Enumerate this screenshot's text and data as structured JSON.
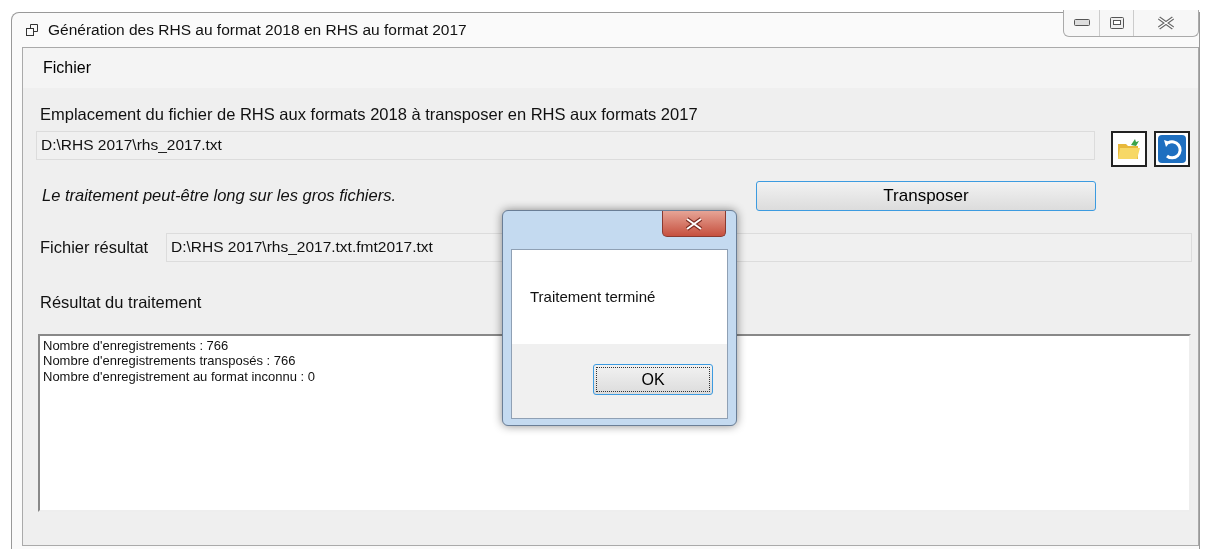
{
  "window": {
    "title": "Génération des RHS au format 2018 en RHS au format 2017"
  },
  "menu": [
    {
      "label": "Fichier"
    }
  ],
  "source": {
    "label": "Emplacement du fichier de RHS aux formats 2018 à transposer en RHS aux formats 2017",
    "value": "D:\\RHS 2017\\rhs_2017.txt"
  },
  "note": "Le traitement peut-être long sur les gros fichiers.",
  "transpose_button": "Transposer",
  "result_file": {
    "label": "Fichier résultat",
    "value": "D:\\RHS 2017\\rhs_2017.txt.fmt2017.txt"
  },
  "result": {
    "label": "Résultat du traitement",
    "lines": [
      "Nombre d'enregistrements : 766",
      "Nombre d'enregistrements transposés : 766",
      "Nombre d'enregistrement au format inconnu : 0"
    ]
  },
  "dialog": {
    "message": "Traitement terminé",
    "button": "OK"
  }
}
